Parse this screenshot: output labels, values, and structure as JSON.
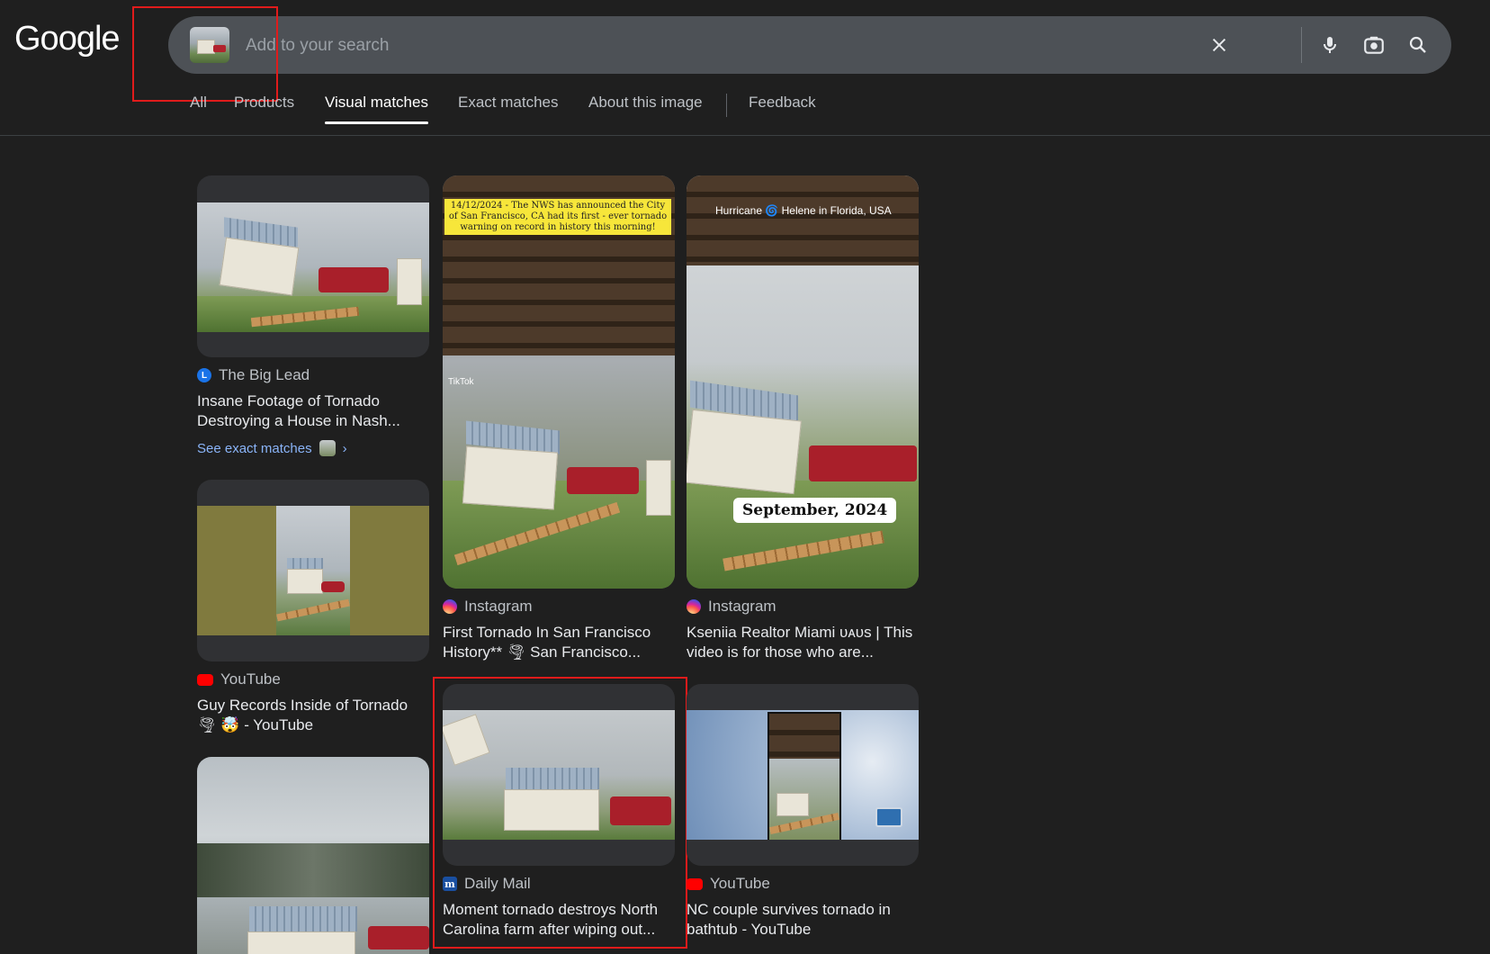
{
  "header": {
    "logo": "Google",
    "search": {
      "placeholder": "Add to your search"
    }
  },
  "tabs": [
    {
      "label": "All"
    },
    {
      "label": "Products"
    },
    {
      "label": "Visual matches",
      "active": true
    },
    {
      "label": "Exact matches"
    },
    {
      "label": "About this image"
    },
    {
      "label": "Feedback"
    }
  ],
  "results": [
    {
      "source": "The Big Lead",
      "title": "Insane Footage of Tornado Destroying a House in Nash...",
      "exact_link": "See exact matches",
      "exact_chevron": "›"
    },
    {
      "source": "Instagram",
      "title": "First Tornado In San Francisco History** 🌪 San Francisco...",
      "caption": "14/12/2024 - The NWS has announced the City of San Francisco, CA had its first - ever tornado warning on record in history this morning!",
      "watermark": "TikTok"
    },
    {
      "source": "Instagram",
      "title": "Kseniia Realtor Miami ᴜᴀᴜs | This video is for those who are...",
      "overlay": "Hurricane 🌀 Helene in Florida, USA",
      "date_label": "September, 2024"
    },
    {
      "source": "YouTube",
      "title": "Guy Records Inside of Tornado 🌪 🤯 - YouTube"
    },
    {
      "source": "Daily Mail",
      "title": "Moment tornado destroys North Carolina farm after wiping out..."
    },
    {
      "source": "YouTube",
      "title": "NC couple survives tornado in bathtub - YouTube"
    }
  ],
  "colors": {
    "background": "#1f1f1f",
    "searchbar": "#4d5156",
    "link": "#8ab4f8",
    "highlight": "#e01b1b"
  }
}
